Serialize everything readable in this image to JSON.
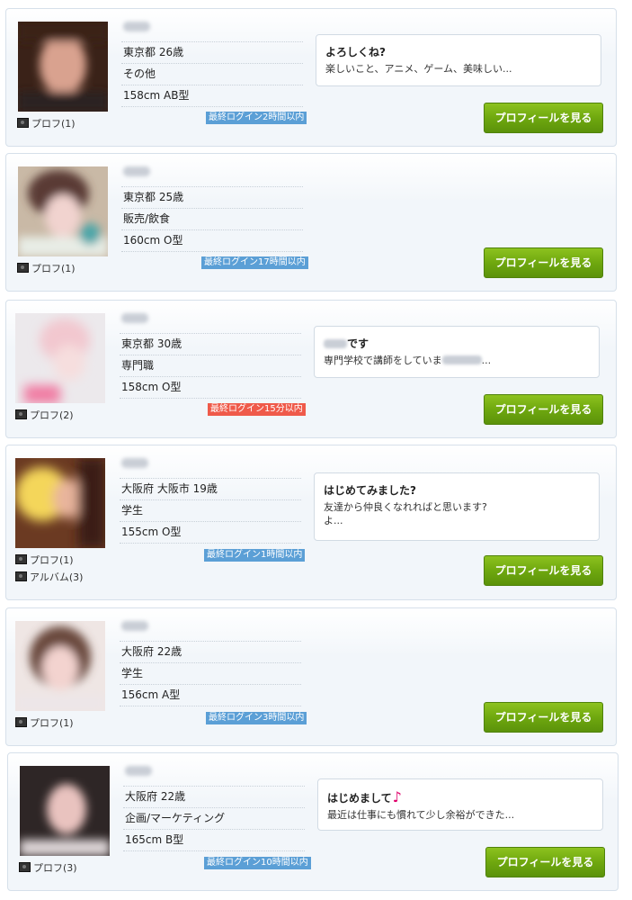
{
  "profiles": [
    {
      "info": [
        "東京都 26歳",
        "その他",
        "158cm AB型"
      ],
      "login": "最終ログイン2時間以内",
      "login_color": "#5b9fd6",
      "links": [
        "プロフ(1)"
      ],
      "message": {
        "title": "よろしくね?",
        "body": "楽しいこと、アニメ、ゲーム、美味しい..."
      },
      "button": "プロフィールを見る"
    },
    {
      "info": [
        "東京都 25歳",
        "販売/飲食",
        "160cm O型"
      ],
      "login": "最終ログイン17時間以内",
      "login_color": "#5b9fd6",
      "links": [
        "プロフ(1)"
      ],
      "button": "プロフィールを見る"
    },
    {
      "info": [
        "東京都 30歳",
        "専門職",
        "158cm O型"
      ],
      "login": "最終ログイン15分以内",
      "login_color": "#ef5a4a",
      "links": [
        "プロフ(2)"
      ],
      "message": {
        "title": "です",
        "body_prefix": "専門学校で講師をしていま",
        "body_suffix": "..."
      },
      "button": "プロフィールを見る"
    },
    {
      "info": [
        "大阪府 大阪市 19歳",
        "学生",
        "155cm O型"
      ],
      "login": "最終ログイン1時間以内",
      "login_color": "#5b9fd6",
      "links": [
        "プロフ(1)",
        "アルバム(3)"
      ],
      "message": {
        "title": "はじめてみました?",
        "body": "友達から仲良くなれればと思います?\nよ..."
      },
      "button": "プロフィールを見る"
    },
    {
      "info": [
        "大阪府 22歳",
        "学生",
        "156cm A型"
      ],
      "login": "最終ログイン3時間以内",
      "login_color": "#5b9fd6",
      "links": [
        "プロフ(1)"
      ],
      "button": "プロフィールを見る"
    },
    {
      "info": [
        "大阪府 22歳",
        "企画/マーケティング",
        "165cm B型"
      ],
      "login": "最終ログイン10時間以内",
      "login_color": "#5b9fd6",
      "links": [
        "プロフ(3)"
      ],
      "message": {
        "title": "はじめまして",
        "title_icon": "♪",
        "body": "最近は仕事にも慣れて少し余裕ができた..."
      },
      "button": "プロフィールを見る"
    }
  ]
}
